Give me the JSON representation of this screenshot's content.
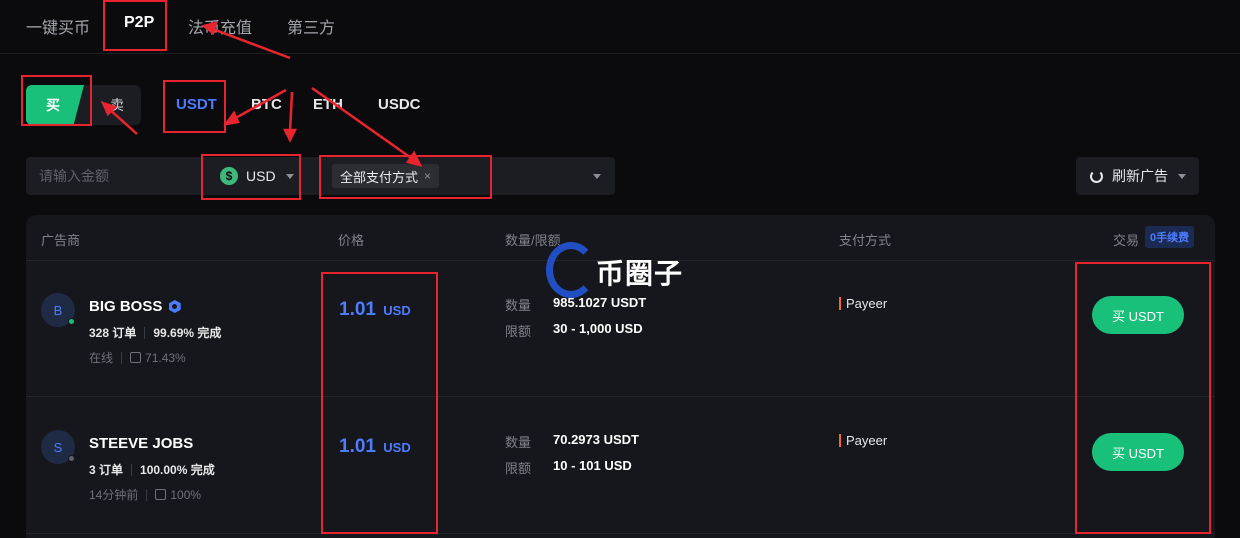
{
  "top_tabs": [
    "一键买币",
    "P2P",
    "法币充值",
    "第三方"
  ],
  "side": {
    "buy": "买",
    "sell": "卖"
  },
  "coins": [
    "USDT",
    "BTC",
    "ETH",
    "USDC"
  ],
  "filters": {
    "amount_placeholder": "请输入金额",
    "currency_icon": "$",
    "currency": "USD",
    "payment_chip": "全部支付方式",
    "chip_close": "×",
    "refresh": "刷新广告"
  },
  "table": {
    "headers": {
      "advertiser": "广告商",
      "price": "价格",
      "amount": "数量/限额",
      "payment": "支付方式",
      "trade": "交易"
    },
    "fee_badge": "0手续费",
    "qty_label": "数量",
    "limit_label": "限额",
    "rows": [
      {
        "avatar": "B",
        "online_color": "#19c07a",
        "name": "BIG BOSS",
        "orders": "328 订单",
        "completion": "99.69% 完成",
        "status": "在线",
        "rating": "71.43%",
        "price": "1.01",
        "price_unit": "USD",
        "quantity": "985.1027 USDT",
        "limit": "30 - 1,000 USD",
        "payment": "Payeer",
        "button": "买 USDT"
      },
      {
        "avatar": "S",
        "online_color": "#5f626b",
        "name": "STEEVE JOBS",
        "orders": "3 订单",
        "completion": "100.00% 完成",
        "status": "14分钟前",
        "rating": "100%",
        "price": "1.01",
        "price_unit": "USD",
        "quantity": "70.2973 USDT",
        "limit": "10 - 101 USD",
        "payment": "Payeer",
        "button": "买 USDT"
      }
    ]
  },
  "watermark": "币圈子",
  "colors": {
    "accent": "#4d7cff",
    "buy": "#19c07a",
    "annotation": "#e8242e"
  }
}
